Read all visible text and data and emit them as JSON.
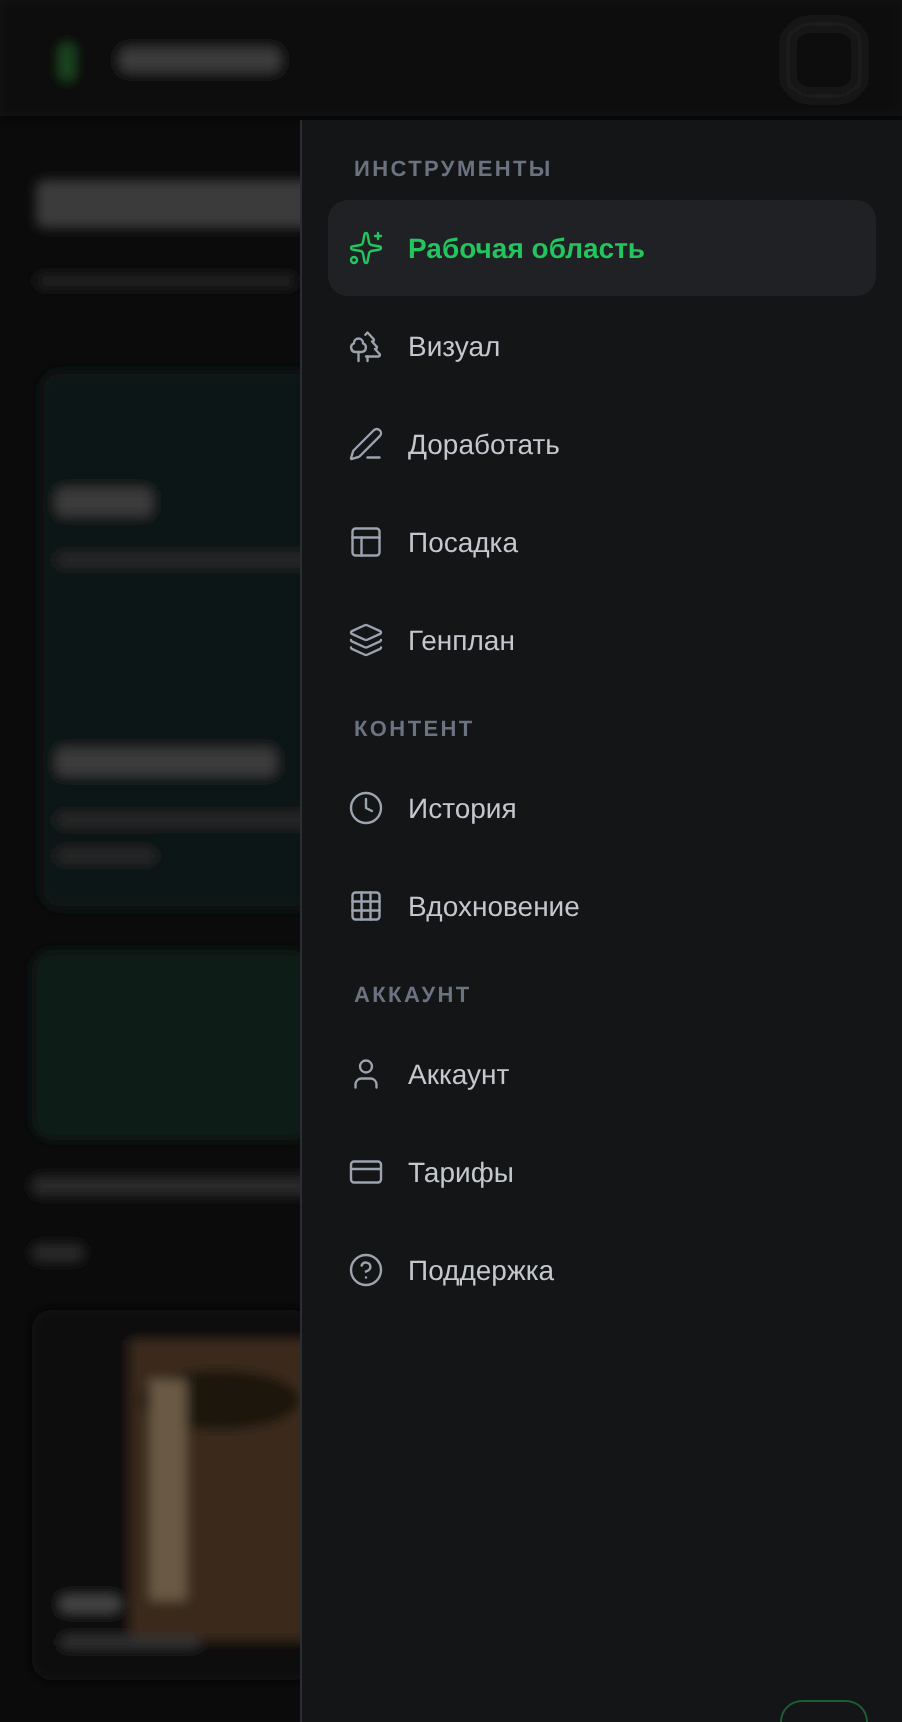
{
  "menu": {
    "sections": [
      {
        "title": "ИНСТРУМЕНТЫ",
        "items": [
          {
            "label": "Рабочая область",
            "selected": true
          },
          {
            "label": "Визуал",
            "selected": false
          },
          {
            "label": "Доработать",
            "selected": false
          },
          {
            "label": "Посадка",
            "selected": false
          },
          {
            "label": "Генплан",
            "selected": false
          }
        ]
      },
      {
        "title": "КОНТЕНТ",
        "items": [
          {
            "label": "История",
            "selected": false
          },
          {
            "label": "Вдохновение",
            "selected": false
          }
        ]
      },
      {
        "title": "АККАУНТ",
        "items": [
          {
            "label": "Аккаунт",
            "selected": false
          },
          {
            "label": "Тарифы",
            "selected": false
          },
          {
            "label": "Поддержка",
            "selected": false
          }
        ]
      }
    ]
  }
}
